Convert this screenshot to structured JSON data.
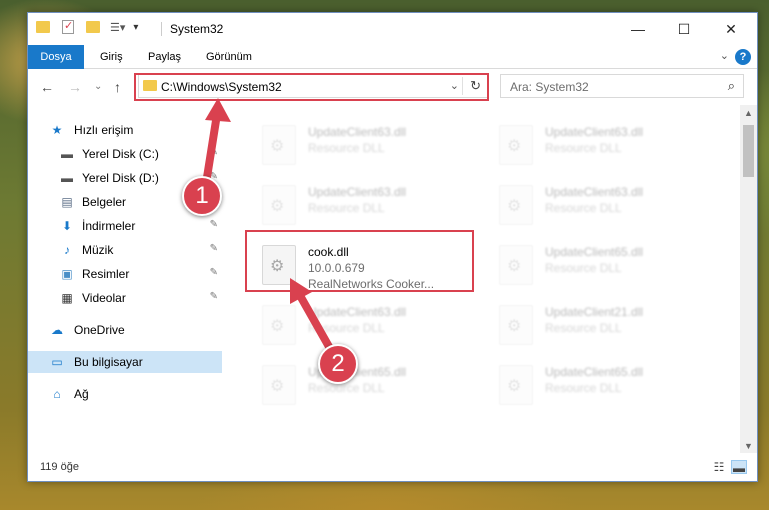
{
  "window": {
    "title": "System32",
    "controls": {
      "minimize": "—",
      "maximize": "☐",
      "close": "✕"
    }
  },
  "ribbon": {
    "tabs": [
      "Dosya",
      "Giriş",
      "Paylaş",
      "Görünüm"
    ],
    "active_tab": "Dosya",
    "expand_glyph": "⌄",
    "help_glyph": "?"
  },
  "nav": {
    "back": "←",
    "forward": "→",
    "recent": "⌄",
    "up": "↑",
    "address": "C:\\Windows\\System32",
    "address_dropdown": "⌄",
    "refresh": "↻",
    "search_placeholder": "Ara: System32",
    "search_glyph": "⌕"
  },
  "sidebar": {
    "items": [
      {
        "label": "Hızlı erişim",
        "icon": "star-icon",
        "glyph": "★",
        "color": "#1979ca",
        "pinned": false,
        "indent": 0
      },
      {
        "label": "Yerel Disk (C:)",
        "icon": "drive-icon",
        "glyph": "▬",
        "color": "#555555",
        "pinned": true,
        "indent": 1
      },
      {
        "label": "Yerel Disk (D:)",
        "icon": "drive-icon",
        "glyph": "▬",
        "color": "#555555",
        "pinned": true,
        "indent": 1
      },
      {
        "label": "Belgeler",
        "icon": "documents-icon",
        "glyph": "▤",
        "color": "#5a6d86",
        "pinned": true,
        "indent": 1
      },
      {
        "label": "İndirmeler",
        "icon": "download-icon",
        "glyph": "⬇",
        "color": "#1979ca",
        "pinned": true,
        "indent": 1
      },
      {
        "label": "Müzik",
        "icon": "music-icon",
        "glyph": "♪",
        "color": "#1979ca",
        "pinned": true,
        "indent": 1
      },
      {
        "label": "Resimler",
        "icon": "pictures-icon",
        "glyph": "▣",
        "color": "#4a8fc7",
        "pinned": true,
        "indent": 1
      },
      {
        "label": "Videolar",
        "icon": "videos-icon",
        "glyph": "▦",
        "color": "#333333",
        "pinned": true,
        "indent": 1
      },
      {
        "label": "OneDrive",
        "icon": "cloud-icon",
        "glyph": "☁",
        "color": "#1979ca",
        "pinned": false,
        "indent": 0
      },
      {
        "label": "Bu bilgisayar",
        "icon": "computer-icon",
        "glyph": "▭",
        "color": "#1979ca",
        "pinned": false,
        "indent": 0,
        "selected": true
      },
      {
        "label": "Ağ",
        "icon": "network-icon",
        "glyph": "⌂",
        "color": "#1979ca",
        "pinned": false,
        "indent": 0
      }
    ],
    "pin_glyph": "📌"
  },
  "files": [
    {
      "name": "UpdateClient63.dll",
      "desc": "Resource DLL",
      "faded": true
    },
    {
      "name": "UpdateClient63.dll",
      "desc": "Resource DLL",
      "faded": true
    },
    {
      "name": "UpdateClient63.dll",
      "desc": "Resource DLL",
      "faded": true
    },
    {
      "name": "UpdateClient63.dll",
      "desc": "Resource DLL",
      "faded": true
    },
    {
      "name": "cook.dll",
      "desc": "10.0.0.679",
      "desc2": "RealNetworks Cooker...",
      "faded": false
    },
    {
      "name": "UpdateClient65.dll",
      "desc": "Resource DLL",
      "faded": true
    },
    {
      "name": "UpdateClient63.dll",
      "desc": "Resource DLL",
      "faded": true
    },
    {
      "name": "UpdateClient21.dll",
      "desc": "Resource DLL",
      "faded": true
    },
    {
      "name": "UpdateClient65.dll",
      "desc": "Resource DLL",
      "faded": true
    },
    {
      "name": "UpdateClient65.dll",
      "desc": "Resource DLL",
      "faded": true
    }
  ],
  "status": {
    "count": "119 öğe"
  },
  "annotations": {
    "markers": [
      "1",
      "2"
    ],
    "accent": "#d9414f"
  },
  "colors": {
    "accent": "#1979ca",
    "selection": "#cce4f7"
  }
}
